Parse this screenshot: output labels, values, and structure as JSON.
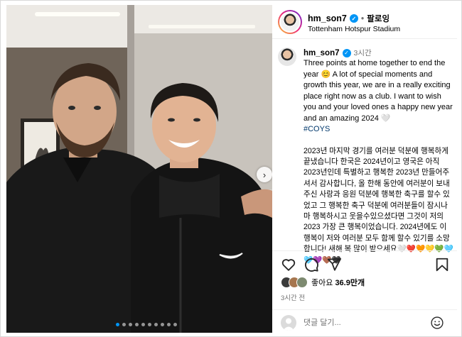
{
  "post": {
    "username": "hm_son7",
    "follow_label": "팔로잉",
    "separator": "•",
    "location": "Tottenham Hotspur Stadium",
    "time_short": "3시간",
    "caption_en": "Three points at home together to end the year 😊 A lot of special moments and growth this year, we are in a really exciting place right now as a club. I want to wish you and your loved ones a happy new year and an amazing 2024 🤍",
    "hashtag": "#COYS",
    "caption_ko": "2023년 마지막 경기를 여러분 덕분에 행복하게 끝냈습니다 한국은 2024년이고 영국은 아직 2023년인데 특별하고 행복한 2023년 만들어주셔서 감사합니다, 올 한해 동안에 여러분이 보내주신 사랑과 응원 덕분에 행복한 축구를 할수 있었고 그 행복한 축구 덕분에 여러분들이 잠시나마 행복하시고 웃을수있으셨다면 그것이 저의 2023 가장 큰 행복이었습니다. 2024년에도 이 행복이 저와 여러분 모두 함께 할수 있기를 소망합니다! 새해 복 많이 받으세요🤍❤️🧡💛💚🩵🩵💜🤎🖤",
    "likes_prefix": "좋아요",
    "likes_count": "36.9만개",
    "time_ago": "3시간 전",
    "comment_placeholder": "댓글 달기..."
  },
  "carousel": {
    "slide_count": 10,
    "active_index": 0,
    "next_icon": "chevron-right-icon"
  },
  "icons": [
    "heart-icon",
    "comment-icon",
    "share-icon",
    "bookmark-icon",
    "emoji-icon",
    "verified-icon"
  ],
  "colors": {
    "verified": "#0095f6",
    "hashtag": "#00376b",
    "secondary_text": "#737373",
    "active_dot": "#0095f6"
  }
}
